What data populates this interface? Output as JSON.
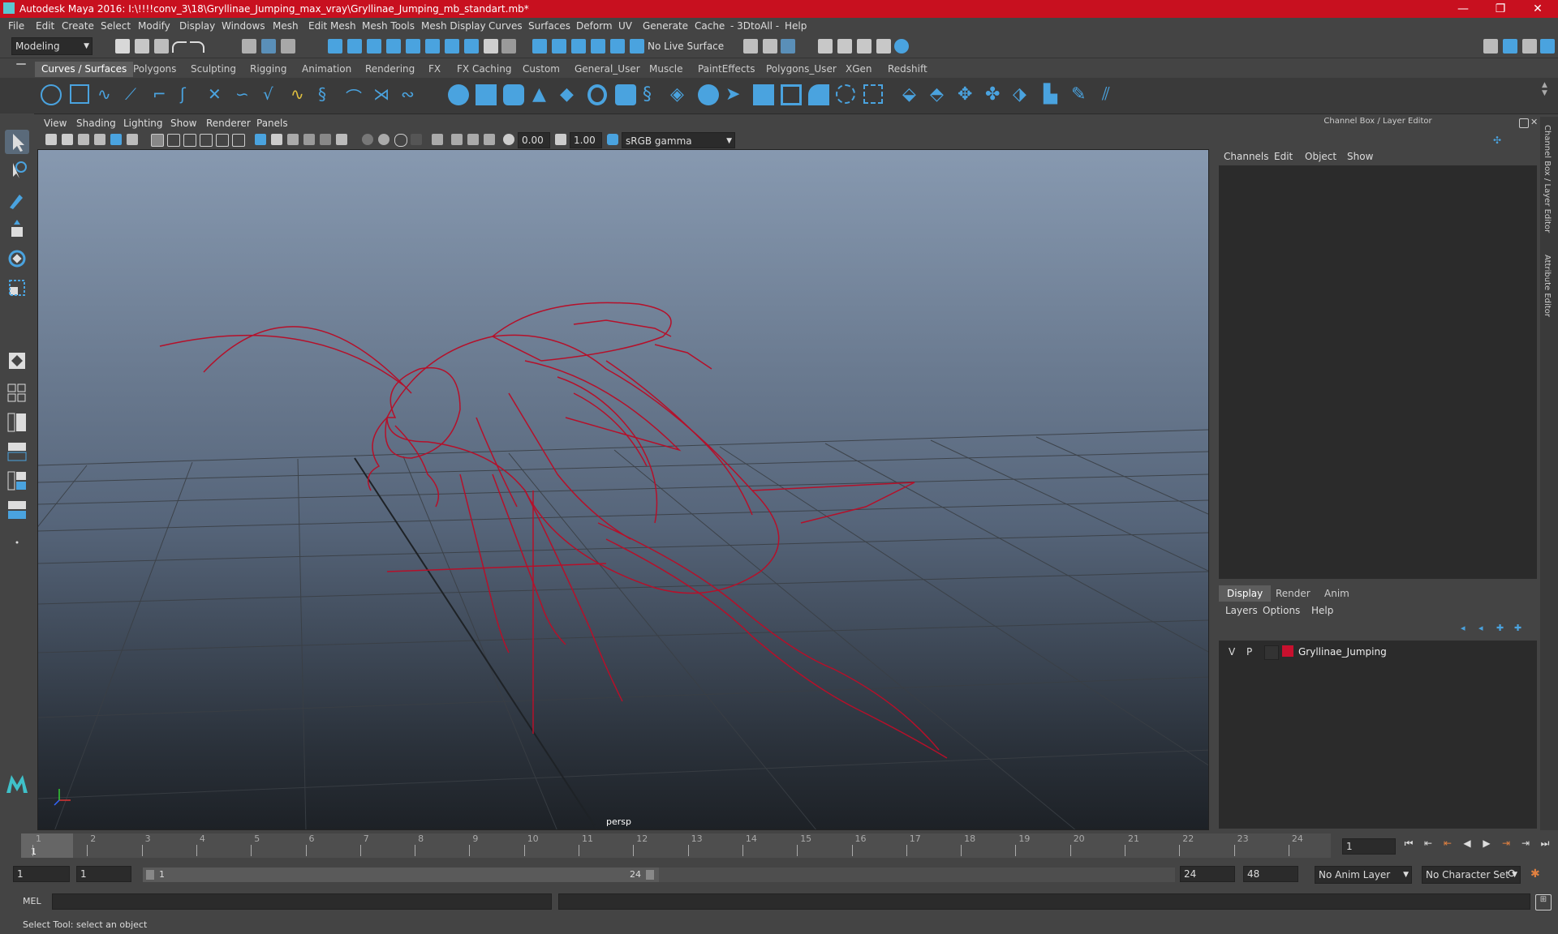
{
  "window": {
    "title": "Autodesk Maya 2016: I:\\!!!!conv_3\\18\\Gryllinae_Jumping_max_vray\\Gryllinae_Jumping_mb_standart.mb*",
    "minimize": "—",
    "restore": "❐",
    "close": "✕"
  },
  "menu": [
    "File",
    "Edit",
    "Create",
    "Select",
    "Modify",
    "Display",
    "Windows",
    "Mesh",
    "Edit Mesh",
    "Mesh Tools",
    "Mesh Display",
    "Curves",
    "Surfaces",
    "Deform",
    "UV",
    "Generate",
    "Cache",
    "- 3DtoAll -",
    "Help"
  ],
  "status": {
    "mode": "Modeling",
    "live_surface": "No Live Surface"
  },
  "shelf_tabs": [
    "Curves / Surfaces",
    "Polygons",
    "Sculpting",
    "Rigging",
    "Animation",
    "Rendering",
    "FX",
    "FX Caching",
    "Custom",
    "General_User",
    "Muscle",
    "PaintEffects",
    "Polygons_User",
    "XGen",
    "Redshift"
  ],
  "viewport": {
    "menu": [
      "View",
      "Shading",
      "Lighting",
      "Show",
      "Renderer",
      "Panels"
    ],
    "exposure": "0.00",
    "gamma": "1.00",
    "color_space": "sRGB gamma",
    "camera": "persp"
  },
  "channel_box": {
    "title": "Channel Box / Layer Editor",
    "menu": [
      "Channels",
      "Edit",
      "Object",
      "Show"
    ]
  },
  "layer_editor": {
    "tabs": [
      "Display",
      "Render",
      "Anim"
    ],
    "menu": [
      "Layers",
      "Options",
      "Help"
    ],
    "layer": {
      "v": "V",
      "p": "P",
      "name": "Gryllinae_Jumping",
      "color": "#c8102e"
    }
  },
  "side_tabs": [
    "Channel Box / Layer Editor",
    "Attribute Editor"
  ],
  "timeline": {
    "ticks": [
      "1",
      "2",
      "3",
      "4",
      "5",
      "6",
      "7",
      "8",
      "9",
      "10",
      "11",
      "12",
      "13",
      "14",
      "15",
      "16",
      "17",
      "18",
      "19",
      "20",
      "21",
      "22",
      "23",
      "24"
    ],
    "current_frame": "1",
    "frame_field": "1"
  },
  "range": {
    "start": "1",
    "anim_start": "1",
    "slider_start": "1",
    "slider_end": "24",
    "anim_end": "24",
    "end": "48",
    "anim_layer": "No Anim Layer",
    "character_set": "No Character Set"
  },
  "command": {
    "label": "MEL"
  },
  "help_line": "Select Tool: select an object",
  "colors": {
    "accent": "#c8101f",
    "wireframe": "#b5102a"
  }
}
